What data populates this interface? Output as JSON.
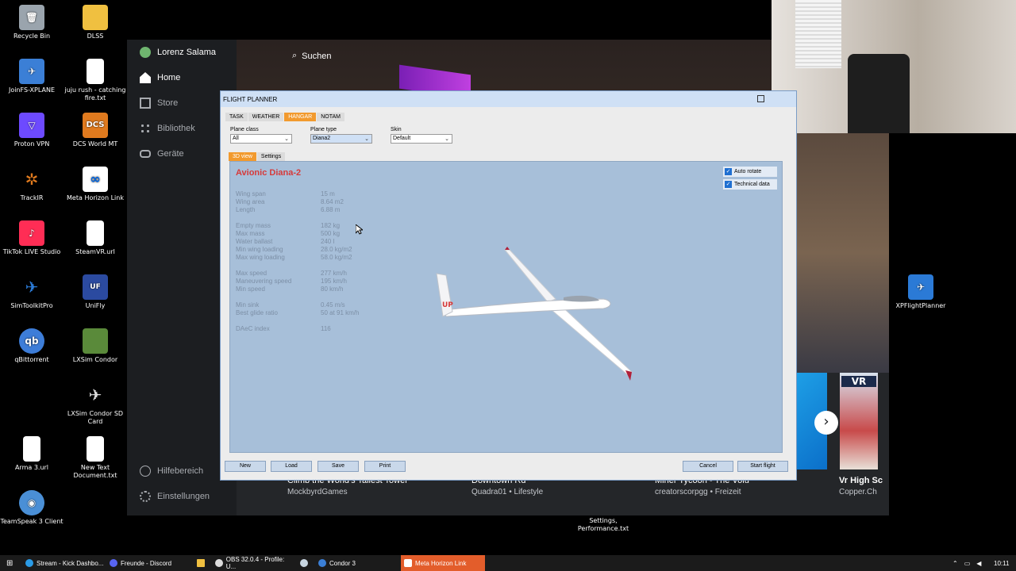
{
  "desktop": {
    "icons": [
      {
        "label": "Recycle Bin",
        "icon": "recycle-bin-icon",
        "color": "#9aa4ad"
      },
      {
        "label": "DLSS",
        "icon": "folder-icon",
        "color": "#f0c040"
      },
      {
        "label": "JoinFS-XPLANE",
        "icon": "plane-icon",
        "color": "#3b7fd6"
      },
      {
        "label": "juju rush - catching fire.txt",
        "icon": "text-file-icon",
        "color": "#ffffff"
      },
      {
        "label": "Proton VPN",
        "icon": "proton-vpn-icon",
        "color": "#6d4aff"
      },
      {
        "label": "DCS World MT",
        "icon": "dcs-icon",
        "color": "#e07a1e"
      },
      {
        "label": "TrackIR",
        "icon": "trackir-icon",
        "color": "#e07a1e"
      },
      {
        "label": "Meta Horizon Link",
        "icon": "meta-icon",
        "color": "#ffffff"
      },
      {
        "label": "TikTok LIVE Studio",
        "icon": "tiktok-icon",
        "color": "#ff2d55"
      },
      {
        "label": "SteamVR.url",
        "icon": "text-file-icon",
        "color": "#ffffff"
      },
      {
        "label": "SimToolkitPro",
        "icon": "plane-icon",
        "color": "#2b7ad6"
      },
      {
        "label": "UniFly",
        "icon": "unifly-icon",
        "color": "#2b4aa0"
      },
      {
        "label": "qBittorrent",
        "icon": "qbittorrent-icon",
        "color": "#3d7dd8"
      },
      {
        "label": "LXSim Condor",
        "icon": "condor-icon",
        "color": "#5a8a3a"
      },
      {
        "label": "LXSim Condor SD Card",
        "icon": "plane-icon",
        "color": "#888888"
      },
      {
        "label": "Arma 3.url",
        "icon": "text-file-icon",
        "color": "#ffffff"
      },
      {
        "label": "New Text Document.txt",
        "icon": "text-file-icon",
        "color": "#ffffff"
      },
      {
        "label": "TeamSpeak 3 Client",
        "icon": "teamspeak-icon",
        "color": "#4a8fd6"
      },
      {
        "label": "XPFlightPlanner",
        "icon": "plane-icon",
        "color": "#2b7ad6"
      },
      {
        "label": "Settings, Performance.txt",
        "icon": "text-file-icon",
        "color": "#ffffff"
      }
    ]
  },
  "meta": {
    "user": "Lorenz Salama",
    "nav": [
      "Home",
      "Store",
      "Bibliothek",
      "Geräte"
    ],
    "nav_bottom": [
      "Hilfebereich",
      "Einstellungen"
    ],
    "search": "Suchen",
    "cards": [
      {
        "title": "Climb the World's Tallest Tower",
        "sub": "MockbyrdGames"
      },
      {
        "title": "Downtown Rd",
        "sub": "Quadra01 • Lifestyle"
      },
      {
        "title": "Miner Tycoon - The Volu",
        "sub": "creatorscorpgg • Freizeit"
      },
      {
        "title": "Vr High Sc",
        "sub": "Copper.Ch"
      }
    ],
    "next_arrow": "›"
  },
  "planner": {
    "title": "FLIGHT PLANNER",
    "tabs": [
      "TASK",
      "WEATHER",
      "HANGAR",
      "NOTAM"
    ],
    "active_tab": "HANGAR",
    "plane_class": {
      "label": "Plane class",
      "value": "All"
    },
    "plane_type": {
      "label": "Plane type",
      "value": "Diana2"
    },
    "skin": {
      "label": "Skin",
      "value": "Default"
    },
    "subtabs": [
      "3D view",
      "Settings"
    ],
    "plane_name": "Avionic Diana-2",
    "specs": [
      {
        "label": "Wing span",
        "value": "15 m"
      },
      {
        "label": "Wing area",
        "value": "8.64 m2"
      },
      {
        "label": "Length",
        "value": "6.88 m"
      },
      {
        "label": "Empty mass",
        "value": "182 kg"
      },
      {
        "label": "Max mass",
        "value": "500 kg"
      },
      {
        "label": "Water ballast",
        "value": "240 l"
      },
      {
        "label": "Min wing loading",
        "value": "28.0 kg/m2"
      },
      {
        "label": "Max wing loading",
        "value": "58.0 kg/m2"
      },
      {
        "label": "Max speed",
        "value": "277 km/h"
      },
      {
        "label": "Maneuvering speed",
        "value": "195 km/h"
      },
      {
        "label": "Min speed",
        "value": "80 km/h"
      },
      {
        "label": "Min sink",
        "value": "0.45 m/s"
      },
      {
        "label": "Best glide ratio",
        "value": "50 at 91 km/h"
      },
      {
        "label": "DAeC index",
        "value": "116"
      }
    ],
    "auto_rotate": "Auto rotate",
    "technical_data": "Technical data",
    "tail_marking": "UP",
    "buttons": {
      "new": "New",
      "load": "Load",
      "save": "Save",
      "print": "Print",
      "cancel": "Cancel",
      "start": "Start flight"
    }
  },
  "taskbar": {
    "items": [
      {
        "label": "Stream - Kick Dashbo...",
        "color": "#53fc18"
      },
      {
        "label": "Freunde - Discord",
        "color": "#5865f2"
      },
      {
        "label": "OBS 32.0.4 - Profile: U...",
        "color": "#dddddd"
      },
      {
        "label": "Condor 3",
        "color": "#3b7fd6"
      },
      {
        "label": "Meta Horizon Link",
        "color": "#ffffff"
      }
    ],
    "clock": "10:11"
  }
}
